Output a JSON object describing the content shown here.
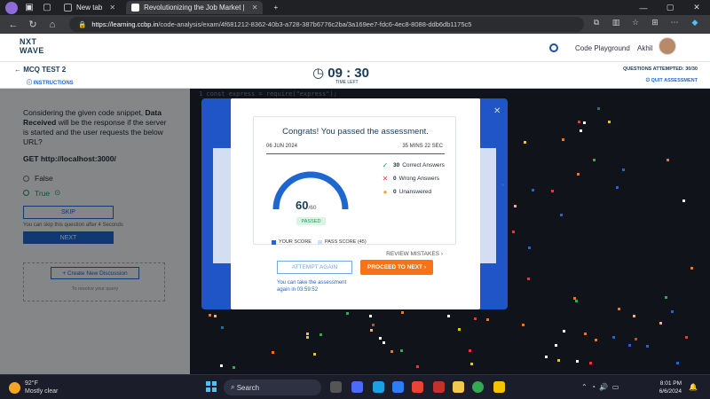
{
  "browser": {
    "tabs": [
      {
        "label": "New tab",
        "active": false
      },
      {
        "label": "Revolutionizing the Job Market |",
        "active": true
      }
    ],
    "new_tab": "+",
    "url_host": "https://learning.ccbp.in",
    "url_path": "/code-analysis/exam/4f681212-8362-40b3-a728-387b6776c2ba/3a169ee7-fdc6-4ec8-8088-ddb6db1175c5"
  },
  "app": {
    "logo_line1": "NXT",
    "logo_line2": "WAVE",
    "code_playground": "Code Playground",
    "user_name": "Akhil",
    "test_title": "MCQ TEST 2",
    "instructions": "INSTRUCTIONS",
    "timer": "09 : 30",
    "time_left": "TIME LEFT",
    "questions_attempted": "QUESTIONS ATTEMPTED: 30/30",
    "quit": "QUIT ASSESSMENT"
  },
  "question": {
    "text_pre": "Considering the given code snippet,",
    "text_bold": "Data Received",
    "text_post": "will be the response if the server is started and the user requests the below URL?",
    "get": "GET http://localhost:3000/",
    "options": [
      "False",
      "True"
    ],
    "skip": "SKIP",
    "skip_hint": "You can skip this question after 4 Seconds",
    "next": "NEXT",
    "create_discussion": "+ Create New Discussion",
    "discussion_hint": "To resolve your query"
  },
  "editor": {
    "line1": "1  const express = require(\"express\");"
  },
  "modal": {
    "title": "Congrats! You passed the assessment.",
    "date": "06 JUN 2024",
    "duration": "35 MINS 22 SEC",
    "score": "60",
    "score_max": "/60",
    "status": "PASSED",
    "score_fraction": 1.0,
    "stats": [
      {
        "count": "30",
        "label": "Correct Answers",
        "icon": "check-icon",
        "color": "#1d9b54"
      },
      {
        "count": "0",
        "label": "Wrong Answers",
        "icon": "cross-icon",
        "color": "#e53935"
      },
      {
        "count": "0",
        "label": "Unanswered",
        "icon": "dot-icon",
        "color": "#f5a524"
      }
    ],
    "legend_your_score": "YOUR SCORE",
    "legend_pass_score": "PASS SCORE (45)",
    "review": "REVIEW MISTAKES",
    "attempt_again": "ATTEMPT AGAIN",
    "proceed": "PROCEED TO NEXT",
    "retake_line1": "You can take the assessment",
    "retake_line2": "again in 03:59:52"
  },
  "taskbar": {
    "temp": "92°F",
    "weather": "Mostly clear",
    "search": "Search",
    "time": "8:01 PM",
    "date": "6/6/2024"
  },
  "colors": {
    "accent": "#1e66d0",
    "orange": "#f97316",
    "success": "#1d9b54"
  }
}
